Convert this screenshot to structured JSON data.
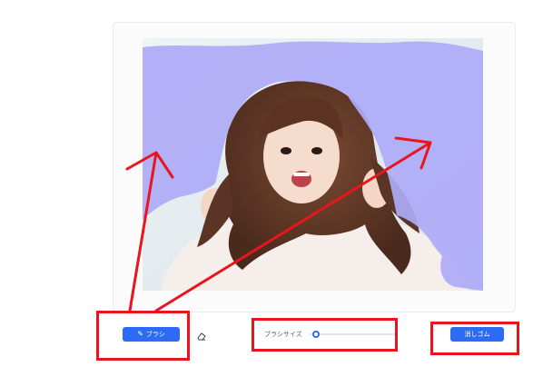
{
  "toolbar": {
    "brush_label": "ブラシ",
    "brush_icon": "pencil-icon",
    "eraser_tool_icon": "eraser-icon",
    "brush_size_label": "ブラシサイズ",
    "brush_size_value": 0.05,
    "eraser_label": "消しゴム"
  },
  "colors": {
    "primary": "#2d6bf3",
    "mask": "#aeaaf6",
    "annotation": "#e8161c"
  }
}
